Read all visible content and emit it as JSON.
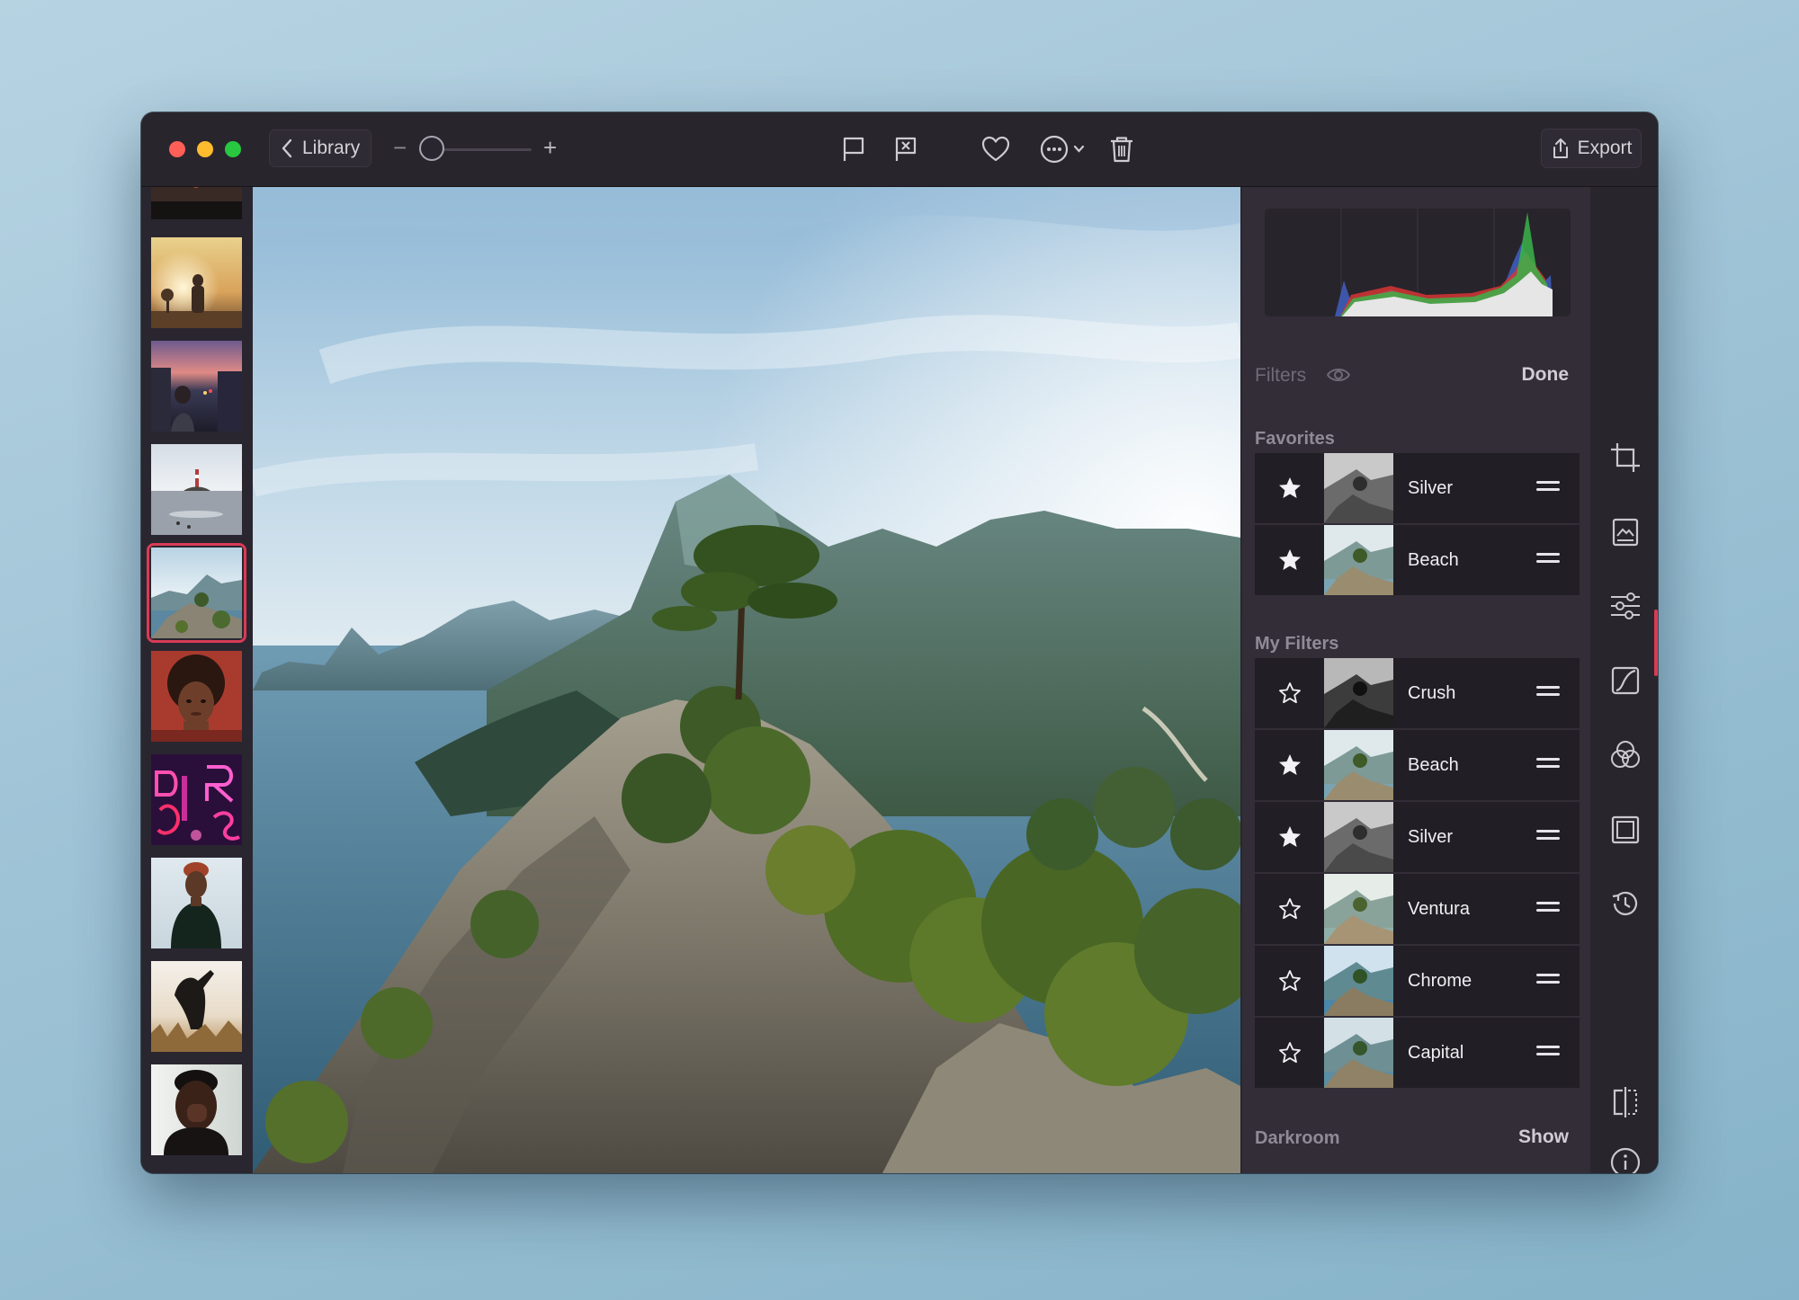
{
  "toolbar": {
    "back_label": "Library",
    "zoom_minus": "−",
    "zoom_plus": "+",
    "export_label": "Export",
    "icons": [
      "flag-icon",
      "reject-flag-icon",
      "heart-icon",
      "more-icon",
      "trash-icon"
    ]
  },
  "panel": {
    "filters_title": "Filters",
    "done_label": "Done",
    "favorites_heading": "Favorites",
    "my_filters_heading": "My Filters",
    "darkroom_heading": "Darkroom",
    "show_label": "Show",
    "favorites": [
      {
        "name": "Silver",
        "starred": true
      },
      {
        "name": "Beach",
        "starred": true
      }
    ],
    "my_filters": [
      {
        "name": "Crush",
        "starred": false
      },
      {
        "name": "Beach",
        "starred": true
      },
      {
        "name": "Silver",
        "starred": true
      },
      {
        "name": "Ventura",
        "starred": false
      },
      {
        "name": "Chrome",
        "starred": false
      },
      {
        "name": "Capital",
        "starred": false
      }
    ]
  },
  "tools": [
    "crop-icon",
    "image-icon",
    "adjust-sliders-icon",
    "curves-icon",
    "color-mix-icon",
    "frame-icon",
    "history-icon",
    "compare-icon",
    "info-icon"
  ],
  "colors": {
    "accent": "#d83b56",
    "panel": "#322d37",
    "row": "#211e25"
  }
}
